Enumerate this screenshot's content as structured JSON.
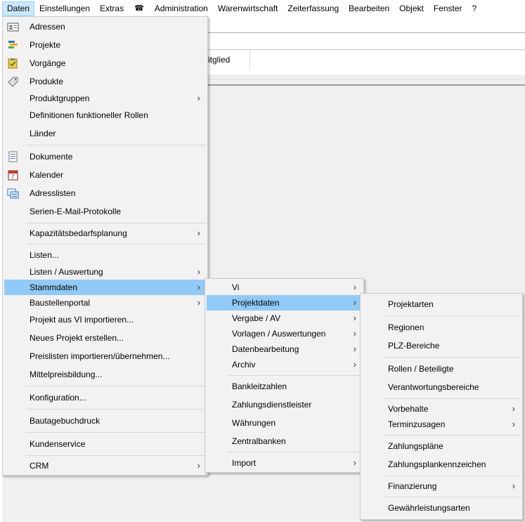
{
  "menubar": {
    "items": [
      {
        "label": "Daten",
        "active": true
      },
      {
        "label": "Einstellungen"
      },
      {
        "label": "Extras"
      },
      {
        "label": "☎",
        "icon": "phone-icon"
      },
      {
        "label": "Administration"
      },
      {
        "label": "Warenwirtschaft"
      },
      {
        "label": "Zeiterfassung"
      },
      {
        "label": "Bearbeiten"
      },
      {
        "label": "Objekt"
      },
      {
        "label": "Fenster"
      },
      {
        "label": "?"
      }
    ]
  },
  "background": {
    "tab_fragment": "itglied"
  },
  "daten_menu": {
    "items": [
      {
        "label": "Adressen",
        "icon": "address-card-icon"
      },
      {
        "label": "Projekte",
        "icon": "projects-icon"
      },
      {
        "label": "Vorgänge",
        "icon": "clipboard-icon"
      },
      {
        "label": "Produkte",
        "icon": "tag-icon"
      },
      {
        "label": "Produktgruppen",
        "submenu": true
      },
      {
        "label": "Definitionen funktioneller Rollen"
      },
      {
        "label": "Länder"
      },
      {
        "label": "Dokumente",
        "icon": "document-icon"
      },
      {
        "label": "Kalender",
        "icon": "calendar-icon"
      },
      {
        "label": "Adresslisten",
        "icon": "address-list-icon"
      },
      {
        "label": "Serien-E-Mail-Protokolle"
      },
      {
        "label": "Kapazitätsbedarfsplanung",
        "submenu": true
      },
      {
        "label": "Listen..."
      },
      {
        "label": "Listen / Auswertung",
        "submenu": true
      },
      {
        "label": "Stammdaten",
        "submenu": true,
        "highlighted": true
      },
      {
        "label": "Baustellenportal",
        "submenu": true
      },
      {
        "label": "Projekt aus VI importieren..."
      },
      {
        "label": "Neues Projekt erstellen..."
      },
      {
        "label": "Preislisten importieren/übernehmen..."
      },
      {
        "label": "Mittelpreisbildung..."
      },
      {
        "label": "Konfiguration..."
      },
      {
        "label": "Bautagebuchdruck"
      },
      {
        "label": "Kundenservice"
      },
      {
        "label": "CRM",
        "submenu": true
      }
    ]
  },
  "stammdaten_menu": {
    "items": [
      {
        "label": "Vi",
        "submenu": true
      },
      {
        "label": "Projektdaten",
        "submenu": true,
        "highlighted": true
      },
      {
        "label": "Vergabe / AV",
        "submenu": true
      },
      {
        "label": "Vorlagen / Auswertungen",
        "submenu": true
      },
      {
        "label": "Datenbearbeitung",
        "submenu": true
      },
      {
        "label": "Archiv",
        "submenu": true
      },
      {
        "label": "Bankleitzahlen"
      },
      {
        "label": "Zahlungsdienstleister"
      },
      {
        "label": "Währungen"
      },
      {
        "label": "Zentralbanken"
      },
      {
        "label": "Import",
        "submenu": true
      }
    ]
  },
  "projektdaten_menu": {
    "items": [
      {
        "label": "Projektarten"
      },
      {
        "label": "Regionen"
      },
      {
        "label": "PLZ-Bereiche"
      },
      {
        "label": "Rollen / Beteiligte"
      },
      {
        "label": "Verantwortungsbereiche"
      },
      {
        "label": "Vorbehalte",
        "submenu": true
      },
      {
        "label": "Terminzusagen",
        "submenu": true
      },
      {
        "label": "Zahlungspläne"
      },
      {
        "label": "Zahlungsplankennzeichen"
      },
      {
        "label": "Finanzierung",
        "submenu": true
      },
      {
        "label": "Gewährleistungsarten"
      }
    ]
  },
  "arrow_glyph": "›"
}
